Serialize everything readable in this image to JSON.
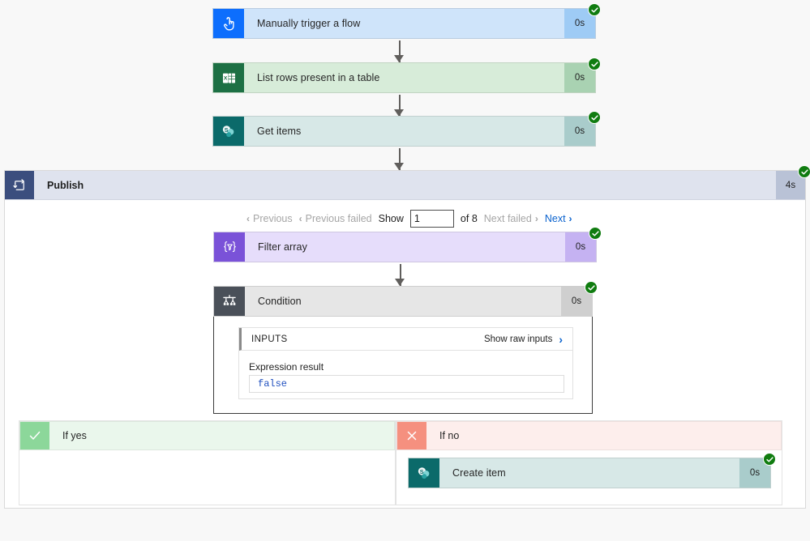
{
  "flow": {
    "steps": [
      {
        "name": "trigger",
        "label": "Manually trigger a flow",
        "duration": "0s",
        "status": "succeeded",
        "icon": "tap-hand-icon"
      },
      {
        "name": "excel",
        "label": "List rows present in a table",
        "duration": "0s",
        "status": "succeeded",
        "icon": "excel-icon"
      },
      {
        "name": "getitems",
        "label": "Get items",
        "duration": "0s",
        "status": "succeeded",
        "icon": "sharepoint-icon"
      }
    ]
  },
  "scope": {
    "title": "Publish",
    "duration": "4s",
    "status": "succeeded",
    "icon": "apply-to-each-loop-icon"
  },
  "pager": {
    "previous": "Previous",
    "previous_failed": "Previous failed",
    "show_label": "Show",
    "page_value": "1",
    "of_label": "of 8",
    "next_failed": "Next failed",
    "next": "Next",
    "chevron_left": "‹",
    "chevron_right": "›"
  },
  "inner": {
    "filter": {
      "label": "Filter array",
      "duration": "0s",
      "status": "succeeded",
      "icon": "filter-braces-icon"
    },
    "condition": {
      "label": "Condition",
      "duration": "0s",
      "status": "succeeded",
      "icon": "condition-branch-icon"
    }
  },
  "inputs": {
    "header": "INPUTS",
    "show_raw": "Show raw inputs",
    "expression_label": "Expression result",
    "expression_value": "false"
  },
  "branches": {
    "yes": {
      "label": "If yes",
      "icon": "check-icon"
    },
    "no": {
      "label": "If no",
      "icon": "cross-icon",
      "action": {
        "label": "Create item",
        "duration": "0s",
        "status": "succeeded",
        "icon": "sharepoint-icon"
      }
    }
  },
  "colors": {
    "accent_link": "#0b63ce",
    "success": "#107c10",
    "scope_header": "#dfe3ee",
    "scope_icon": "#3b4e7e",
    "trigger": "#0d6efd",
    "excel": "#1d7044",
    "sharepoint": "#0b6a6a",
    "filter": "#7a52d8",
    "condition": "#4a5059",
    "yes": "#8cd79a",
    "no": "#f5907f",
    "expression_text": "#1f4fbf"
  }
}
